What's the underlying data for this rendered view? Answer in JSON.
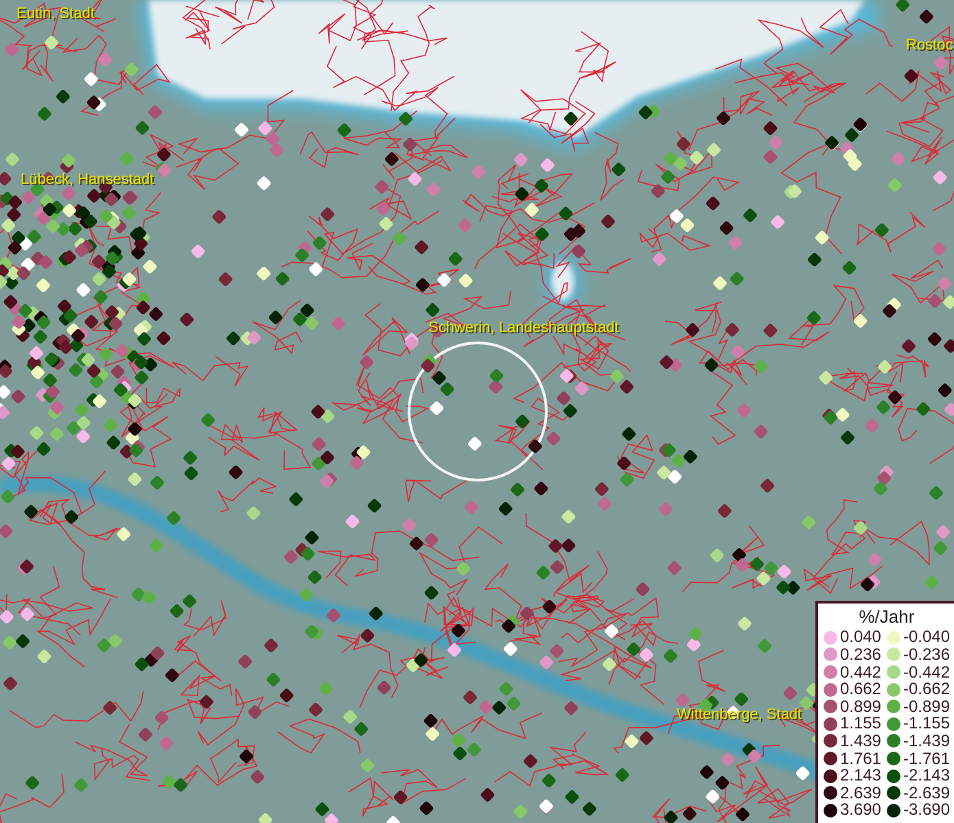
{
  "map": {
    "places": [
      {
        "name": "Eutin, Stadt"
      },
      {
        "name": "Lübeck, Hansestadt"
      },
      {
        "name": "Schwerin, Landeshauptstadt"
      },
      {
        "name": "Wittenberge, Stadt"
      },
      {
        "name": "Rostoc"
      }
    ]
  },
  "legend": {
    "title": "%/Jahr",
    "rows": [
      {
        "positive": {
          "value": "0.040",
          "color": "#f8b8e8"
        },
        "negative": {
          "value": "-0.040",
          "color": "#f0f8c0"
        }
      },
      {
        "positive": {
          "value": "0.236",
          "color": "#e098c8"
        },
        "negative": {
          "value": "-0.236",
          "color": "#c8e8a0"
        }
      },
      {
        "positive": {
          "value": "0.442",
          "color": "#d080a8"
        },
        "negative": {
          "value": "-0.442",
          "color": "#a8d888"
        }
      },
      {
        "positive": {
          "value": "0.662",
          "color": "#c06890"
        },
        "negative": {
          "value": "-0.662",
          "color": "#88c868"
        }
      },
      {
        "positive": {
          "value": "0.899",
          "color": "#a85070"
        },
        "negative": {
          "value": "-0.899",
          "color": "#60b048"
        }
      },
      {
        "positive": {
          "value": "1.155",
          "color": "#904058"
        },
        "negative": {
          "value": "-1.155",
          "color": "#409838"
        }
      },
      {
        "positive": {
          "value": "1.439",
          "color": "#782838"
        },
        "negative": {
          "value": "-1.439",
          "color": "#2c8028"
        }
      },
      {
        "positive": {
          "value": "1.761",
          "color": "#601828"
        },
        "negative": {
          "value": "-1.761",
          "color": "#1a6818"
        }
      },
      {
        "positive": {
          "value": "2.143",
          "color": "#4a0c18"
        },
        "negative": {
          "value": "-2.143",
          "color": "#0c5010"
        }
      },
      {
        "positive": {
          "value": "2.639",
          "color": "#300810"
        },
        "negative": {
          "value": "-2.639",
          "color": "#063808"
        }
      },
      {
        "positive": {
          "value": "3.690",
          "color": "#1c0408"
        },
        "negative": {
          "value": "-3.690",
          "color": "#022404"
        }
      }
    ]
  }
}
